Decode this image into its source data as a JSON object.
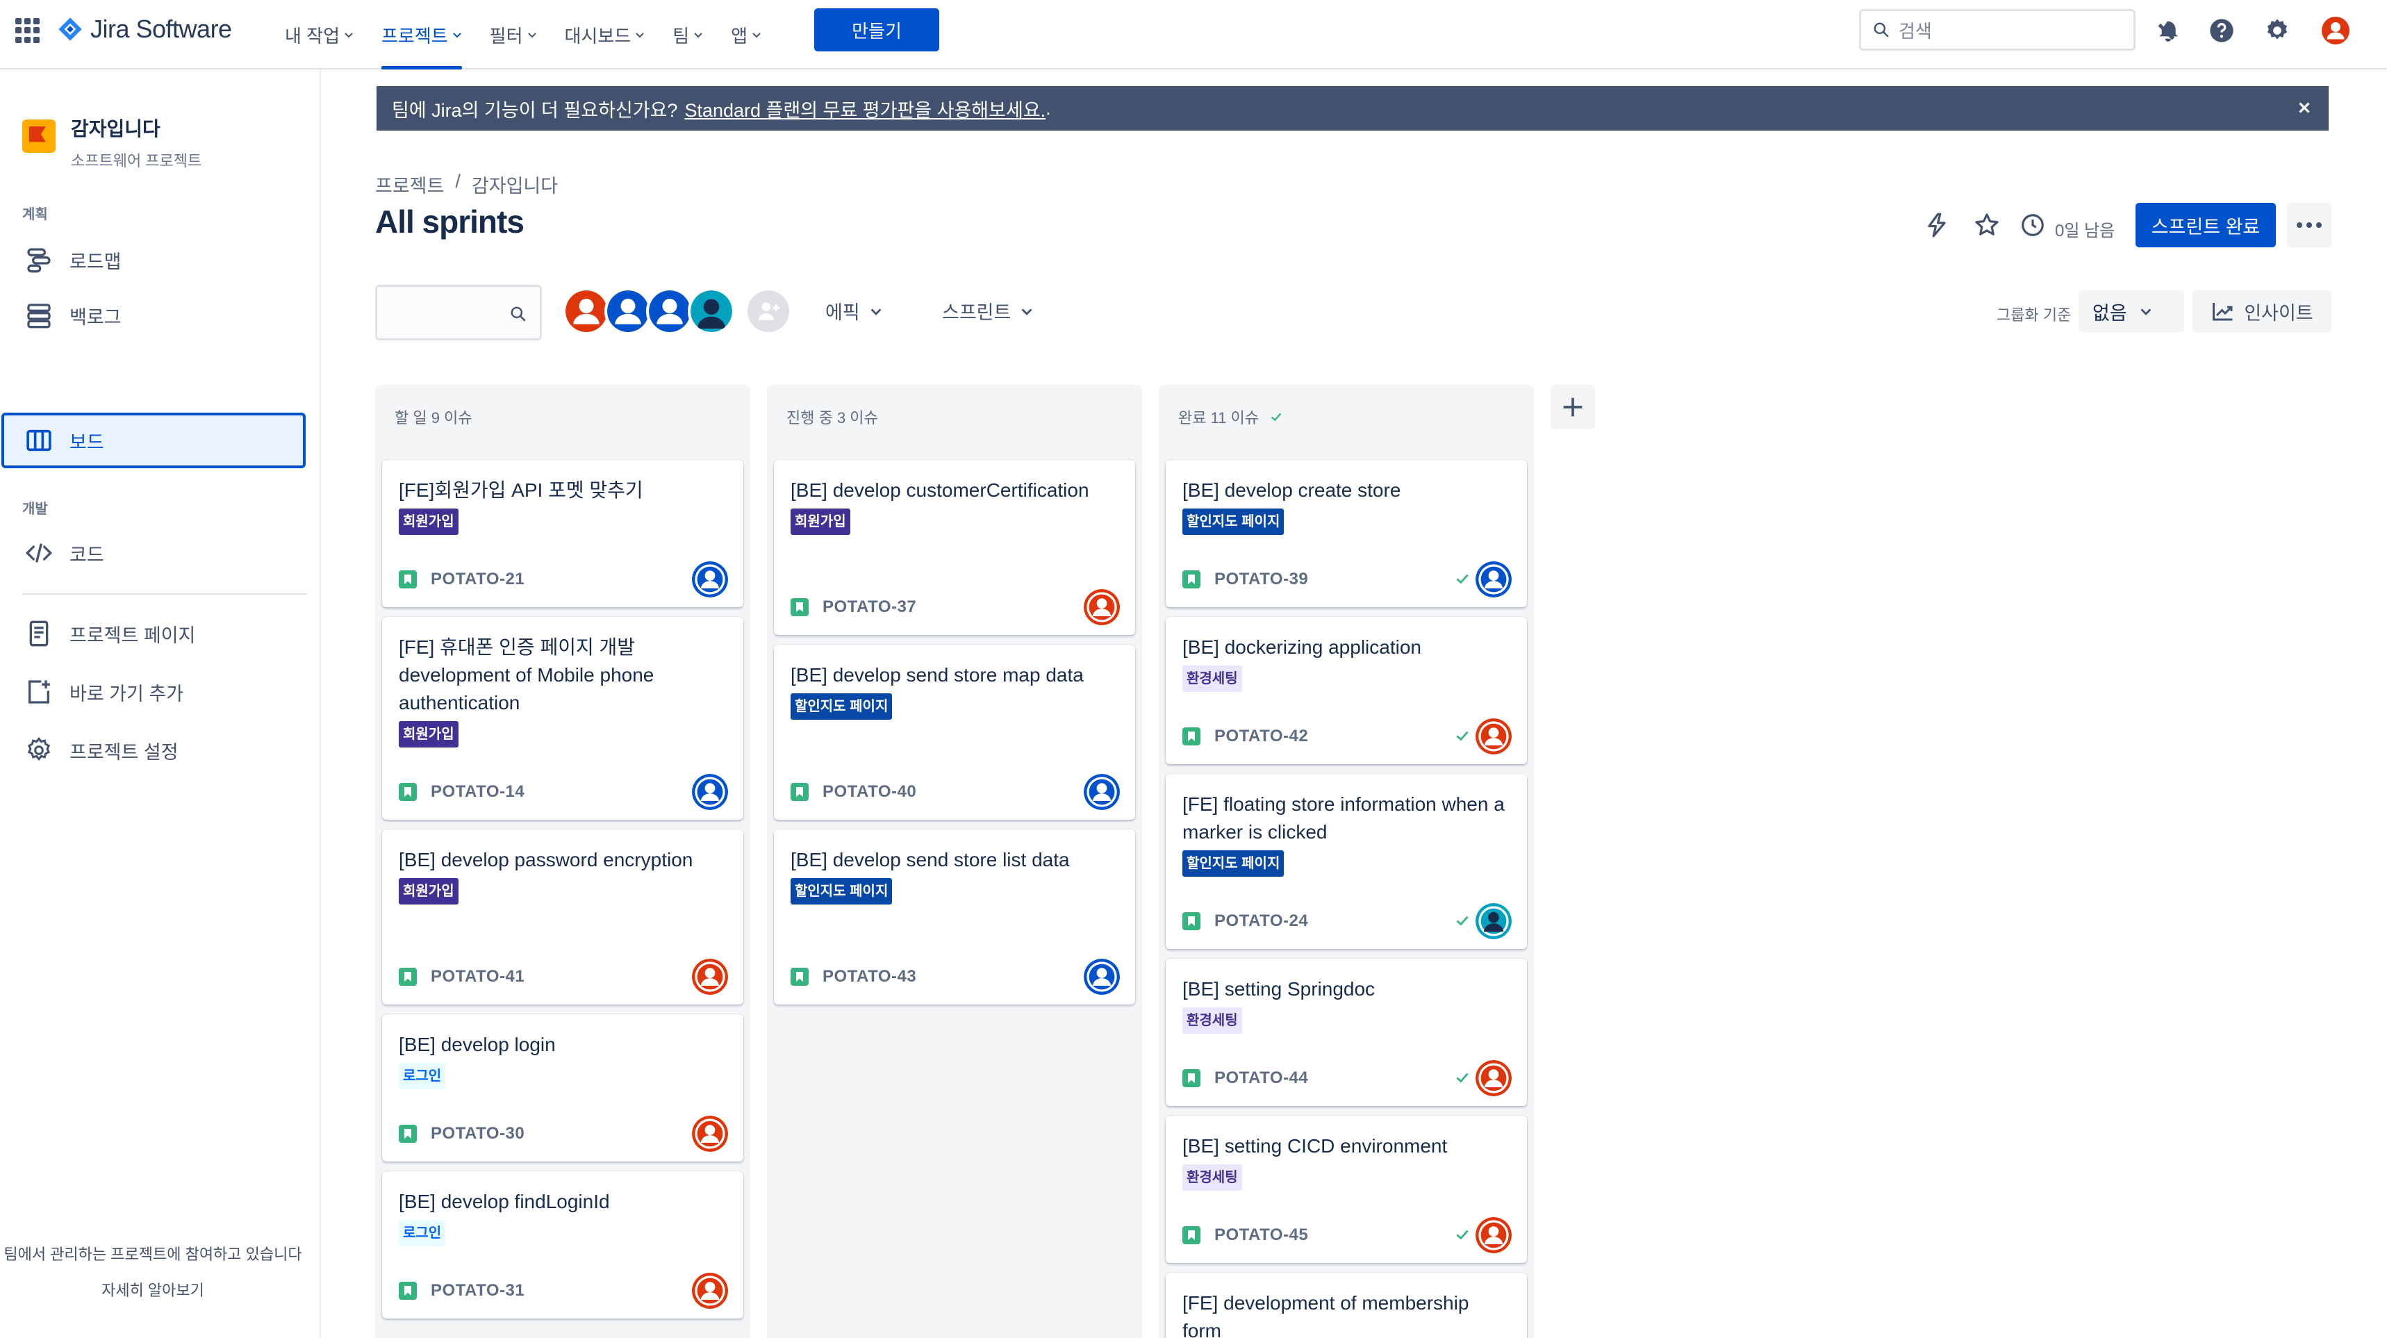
{
  "app": {
    "name": "Jira Software"
  },
  "topnav": {
    "items": [
      {
        "label": "내 작업"
      },
      {
        "label": "프로젝트"
      },
      {
        "label": "필터"
      },
      {
        "label": "대시보드"
      },
      {
        "label": "팀"
      },
      {
        "label": "앱"
      }
    ],
    "create_label": "만들기",
    "search_placeholder": "검색"
  },
  "sidebar": {
    "project_name": "감자입니다",
    "project_type": "소프트웨어 프로젝트",
    "section_plan": "계획",
    "section_dev": "개발",
    "items": [
      {
        "label": "로드맵"
      },
      {
        "label": "백로그"
      },
      {
        "label": "보드"
      },
      {
        "label": "코드"
      },
      {
        "label": "프로젝트 페이지"
      },
      {
        "label": "바로 가기 추가"
      },
      {
        "label": "프로젝트 설정"
      }
    ],
    "footer_text": "팀에서 관리하는 프로젝트에 참여하고 있습니다",
    "footer_link": "자세히 알아보기"
  },
  "banner": {
    "text": "팀에 Jira의 기능이 더 필요하신가요?",
    "link": "Standard 플랜의 무료 평가판을 사용해보세요.",
    "suffix": "."
  },
  "breadcrumb": {
    "root": "프로젝트",
    "sep": "/",
    "project": "감자입니다"
  },
  "page_title": "All sprints",
  "header": {
    "days_left": "0일 남음",
    "complete_label": "스프린트 완료"
  },
  "filters": {
    "epic": "에픽",
    "sprint": "스프린트",
    "group_by_label": "그룹화 기준",
    "group_by_value": "없음",
    "insight_label": "인사이트"
  },
  "colors": {
    "brand": "#0052CC",
    "label_purple": "#403294",
    "label_blue": "#0747A6",
    "done_green": "#36B37E",
    "avatar_red": "#DE350B"
  },
  "columns": [
    {
      "title": "할 일 9 이슈",
      "cards": [
        {
          "title": "[FE]회원가입 API 포멧 맞추기",
          "label": "회원가입",
          "key": "POTATO-21",
          "assignee": "blue"
        },
        {
          "title": "[FE] 휴대폰 인증 페이지 개발 development of Mobile phone authentication",
          "label": "회원가입",
          "key": "POTATO-14",
          "assignee": "blue"
        },
        {
          "title": "[BE] develop password encryption",
          "label": "회원가입",
          "key": "POTATO-41",
          "assignee": "red"
        },
        {
          "title": "[BE] develop login",
          "label": "로그인",
          "key": "POTATO-30",
          "assignee": "red"
        },
        {
          "title": "[BE] develop findLoginId",
          "label": "로그인",
          "key": "POTATO-31",
          "assignee": "red"
        }
      ]
    },
    {
      "title": "진행 중 3 이슈",
      "cards": [
        {
          "title": "[BE] develop customerCertification",
          "label": "회원가입",
          "key": "POTATO-37",
          "assignee": "red"
        },
        {
          "title": "[BE] develop send store map data",
          "label": "할인지도 페이지",
          "key": "POTATO-40",
          "assignee": "blue"
        },
        {
          "title": "[BE] develop send store list data",
          "label": "할인지도 페이지",
          "key": "POTATO-43",
          "assignee": "blue"
        }
      ]
    },
    {
      "title": "완료 11 이슈",
      "cards": [
        {
          "title": "[BE] develop create store",
          "label": "할인지도 페이지",
          "key": "POTATO-39",
          "assignee": "blue"
        },
        {
          "title": "[BE] dockerizing application",
          "label": "환경세팅",
          "key": "POTATO-42",
          "assignee": "red"
        },
        {
          "title": "[FE] floating store information when a marker is clicked",
          "label": "할인지도 페이지",
          "key": "POTATO-24",
          "assignee": "teal"
        },
        {
          "title": "[BE] setting Springdoc",
          "label": "환경세팅",
          "key": "POTATO-44",
          "assignee": "red"
        },
        {
          "title": "[BE] setting CICD environment",
          "label": "환경세팅",
          "key": "POTATO-45",
          "assignee": "red"
        },
        {
          "title": "[FE] development of membership form",
          "label": "",
          "key": "",
          "assignee": ""
        }
      ]
    }
  ]
}
